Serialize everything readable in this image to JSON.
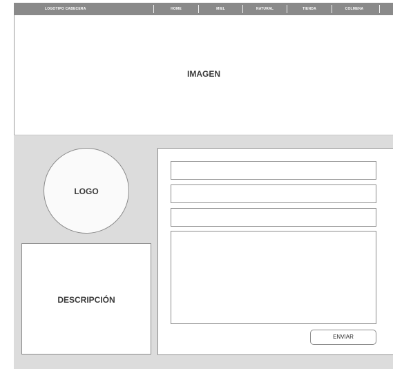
{
  "header": {
    "brand": "LOGOTIPO CABECERA",
    "nav": [
      {
        "label": "HOME"
      },
      {
        "label": "MIEL"
      },
      {
        "label": "NATURAL"
      },
      {
        "label": "TIENDA"
      },
      {
        "label": "COLMENA"
      }
    ]
  },
  "hero": {
    "label": "IMAGEN"
  },
  "logo": {
    "label": "LOGO"
  },
  "description": {
    "label": "DESCRIPCIÓN"
  },
  "form": {
    "submit_label": "ENVIAR"
  },
  "colors": {
    "topbar": "#8a8a8a",
    "panel": "#dcdcdc",
    "border": "#8a8a8a",
    "text": "#3a3a3a"
  }
}
